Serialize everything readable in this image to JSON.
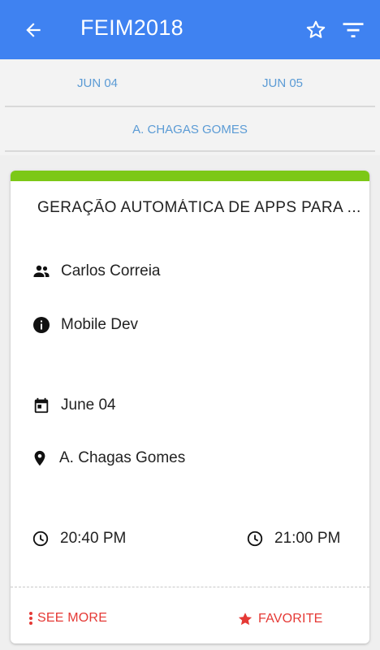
{
  "appbar": {
    "title": "FEIM2018"
  },
  "day_tabs": [
    {
      "label": "JUN 04"
    },
    {
      "label": "JUN 05"
    }
  ],
  "room_tab": {
    "label": "A. CHAGAS GOMES"
  },
  "session": {
    "title": "GERAÇÃO AUTOMÁTICA DE APPS PARA ...",
    "speaker": "Carlos Correia",
    "track": "Mobile Dev",
    "date": "June 04",
    "location": "A. Chagas Gomes",
    "start_time": "20:40 PM",
    "end_time": "21:00 PM",
    "accent_color": "#7cc817"
  },
  "actions": {
    "see_more": "SEE MORE",
    "favorite": "FAVORITE"
  },
  "colors": {
    "appbar": "#3f82f1",
    "tab_text": "#5b9bd5",
    "action": "#e53935"
  }
}
